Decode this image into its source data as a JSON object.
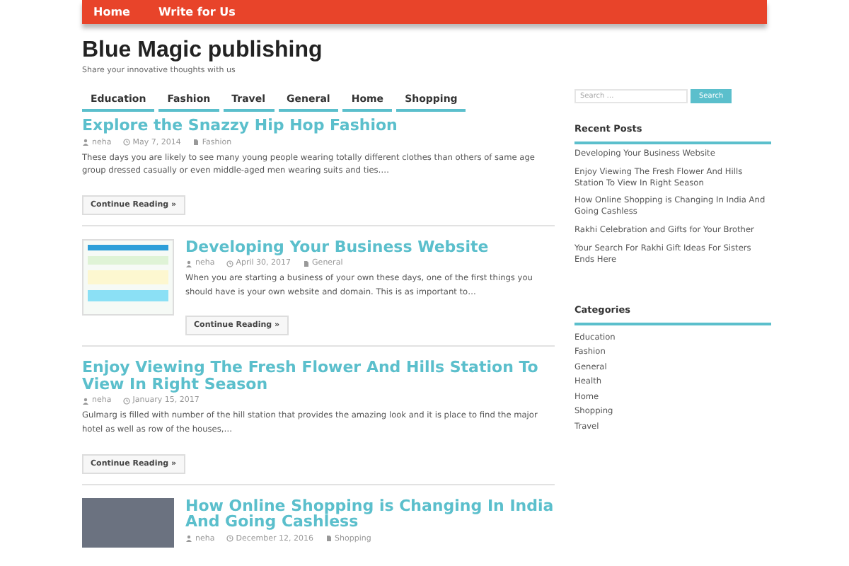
{
  "top_menu": [
    {
      "label": "Home"
    },
    {
      "label": "Write for Us"
    }
  ],
  "site": {
    "title": "Blue Magic publishing",
    "tagline": "Share your innovative thoughts with us"
  },
  "category_menu": [
    "Education",
    "Fashion",
    "Travel",
    "General",
    "Home",
    "Shopping"
  ],
  "posts": [
    {
      "kind": "plain",
      "title": "Explore the Snazzy Hip Hop Fashion",
      "author": "neha",
      "date": "May 7, 2014",
      "category": "Fashion",
      "excerpt": "These days you are likely to see many young people wearing totally different clothes than others of same age group dressed casually or even middle-aged men wearing suits and ties….",
      "button": "Continue Reading »"
    },
    {
      "kind": "screenshot",
      "title": "Developing Your Business Website",
      "author": "neha",
      "date": "April 30, 2017",
      "category": "General",
      "excerpt": "When you are starting a business of your own these days, one of the first things you should have is your own website and domain.  This is as important to…",
      "button": "Continue Reading »"
    },
    {
      "kind": "plain",
      "title": "Enjoy Viewing The Fresh Flower And Hills Station To View In Right Season",
      "author": "neha",
      "date": "January 15, 2017",
      "excerpt": "Gulmarg is filled with number of the hill station that provides the amazing look and it is place to find the major hotel as well as row of the houses,…",
      "button": "Continue Reading »"
    },
    {
      "kind": "photo",
      "title": "How Online Shopping is Changing In India And Going Cashless",
      "author": "neha",
      "date": "December 12, 2016",
      "category": "Shopping"
    }
  ],
  "search": {
    "placeholder": "Search …",
    "button": "Search"
  },
  "recent_posts": {
    "heading": "Recent Posts",
    "items": [
      "Developing Your Business Website",
      "Enjoy Viewing The Fresh Flower And Hills Station To View In Right Season",
      "How Online Shopping is Changing In India And Going Cashless",
      "Rakhi Celebration and Gifts for Your Brother",
      "Your Search For Rakhi Gift Ideas For Sisters Ends Here"
    ]
  },
  "categories": {
    "heading": "Categories",
    "items": [
      "Education",
      "Fashion",
      "General",
      "Health",
      "Home",
      "Shopping",
      "Travel"
    ]
  }
}
